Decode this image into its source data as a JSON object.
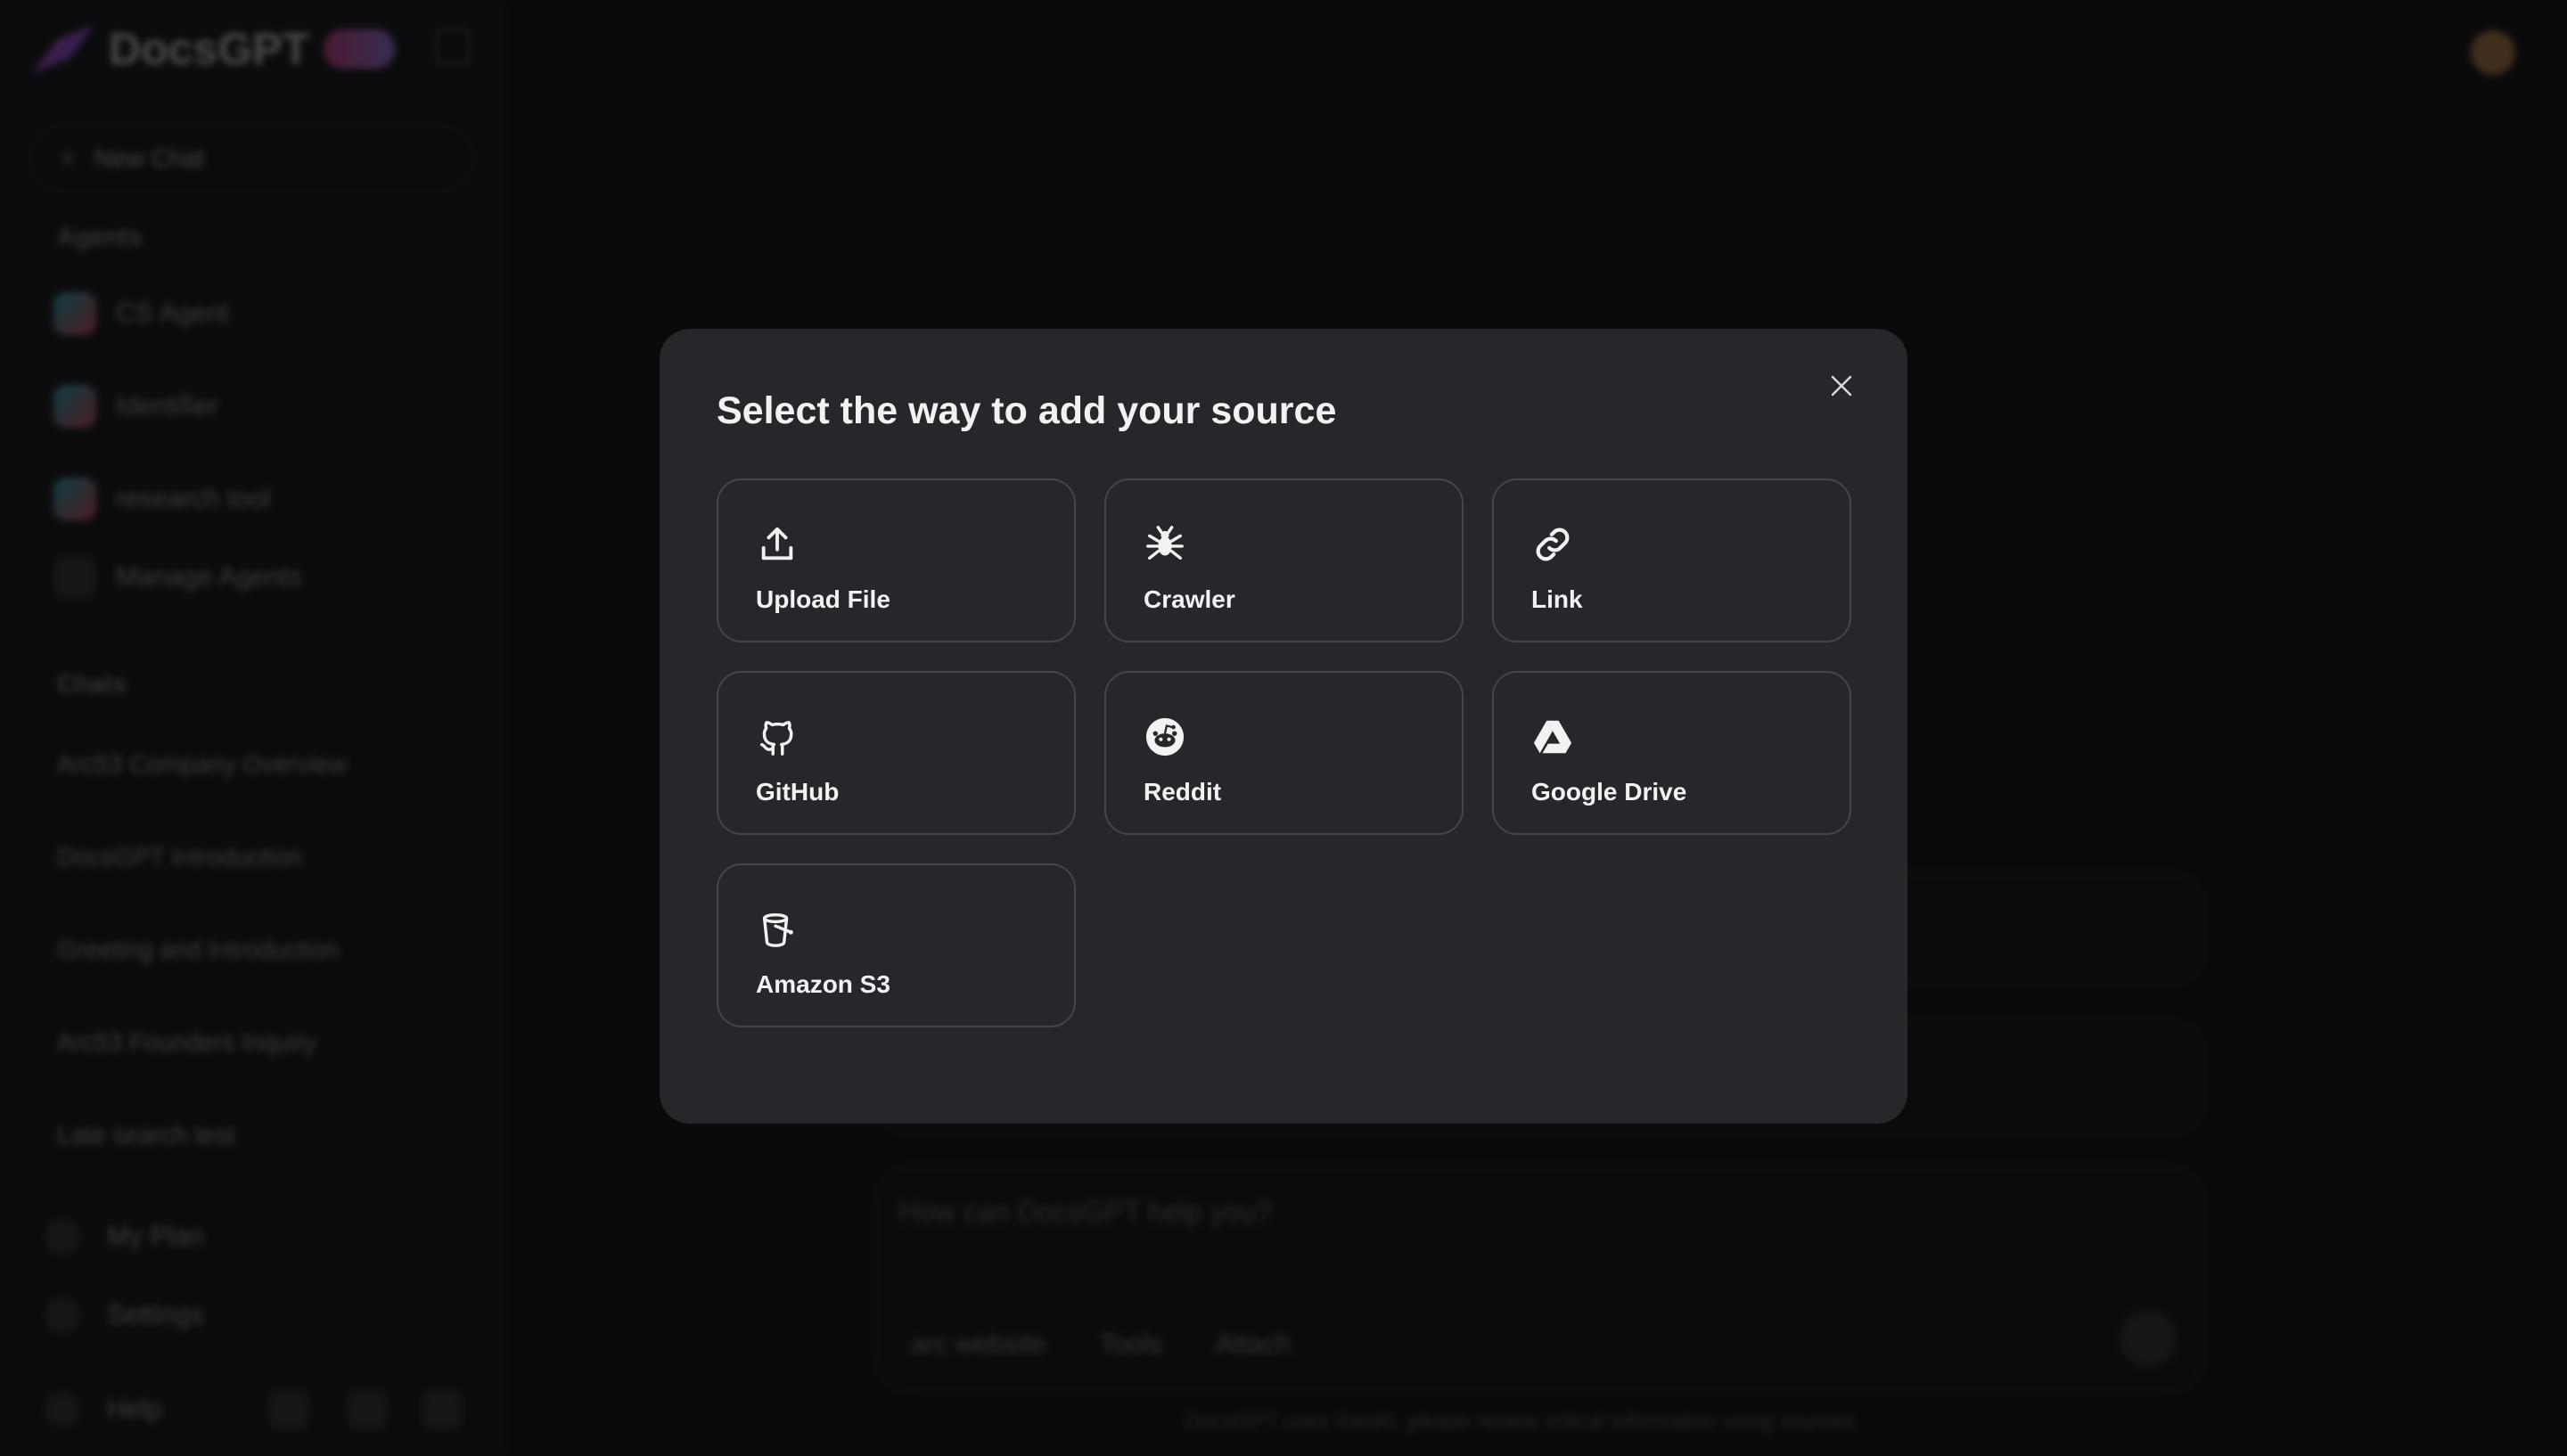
{
  "app": {
    "brand_name": "DocsGPT",
    "new_chat_label": "New Chat",
    "agents_heading": "Agents",
    "agents": [
      {
        "label": "CS Agent"
      },
      {
        "label": "Identifier"
      },
      {
        "label": "research tool"
      },
      {
        "label": "Manage Agents"
      }
    ],
    "chats_heading": "Chats",
    "chats": [
      {
        "label": "Arc53 Company Overview"
      },
      {
        "label": "DocsGPT Introduction"
      },
      {
        "label": "Greeting and Introduction"
      },
      {
        "label": "Arc53 Founders Inquiry"
      },
      {
        "label": "Late search test"
      }
    ],
    "bottom": {
      "my_plan": "My Plan",
      "settings": "Settings",
      "help": "Help"
    },
    "prompt": {
      "placeholder": "How can DocsGPT help you?",
      "source_label": "arc website",
      "tools_label": "Tools",
      "attach_label": "Attach"
    },
    "footer_note": "DocsGPT uses GenAI, please review critical information using sources."
  },
  "modal": {
    "title": "Select the way to add your source",
    "options": [
      {
        "label": "Upload File",
        "icon": "upload-icon"
      },
      {
        "label": "Crawler",
        "icon": "spider-icon"
      },
      {
        "label": "Link",
        "icon": "link-icon"
      },
      {
        "label": "GitHub",
        "icon": "github-icon"
      },
      {
        "label": "Reddit",
        "icon": "reddit-icon"
      },
      {
        "label": "Google Drive",
        "icon": "google-drive-icon"
      },
      {
        "label": "Amazon S3",
        "icon": "amazon-s3-icon"
      }
    ]
  }
}
